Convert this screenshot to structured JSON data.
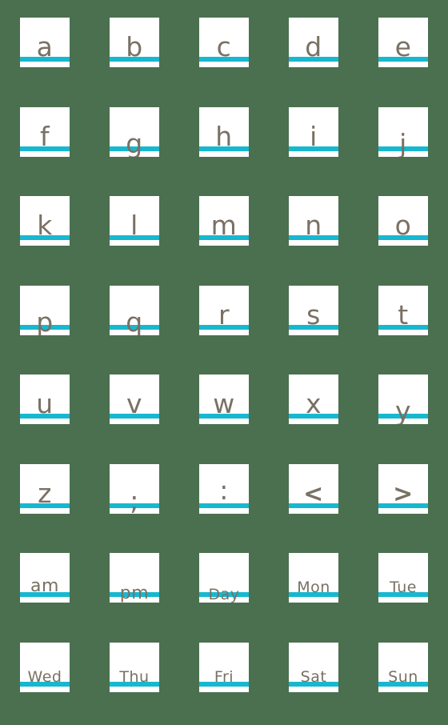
{
  "sheet": {
    "title": "Handwriting Letters and Days Emoji Sheet",
    "background_color": "#4a7050",
    "tile_color": "#ffffff",
    "rule_color": "#17b8cf",
    "glyph_color": "#7a7064",
    "columns": 5,
    "rows": 8
  },
  "tiles": [
    {
      "label": "a",
      "name": "tile-letter-a",
      "size": "s-single",
      "descender": "none"
    },
    {
      "label": "b",
      "name": "tile-letter-b",
      "size": "s-single",
      "descender": "none"
    },
    {
      "label": "c",
      "name": "tile-letter-c",
      "size": "s-single",
      "descender": "none"
    },
    {
      "label": "d",
      "name": "tile-letter-d",
      "size": "s-single",
      "descender": "none"
    },
    {
      "label": "e",
      "name": "tile-letter-e",
      "size": "s-single",
      "descender": "none"
    },
    {
      "label": "f",
      "name": "tile-letter-f",
      "size": "s-single",
      "descender": "none"
    },
    {
      "label": "g",
      "name": "tile-letter-g",
      "size": "s-single",
      "descender": "deep"
    },
    {
      "label": "h",
      "name": "tile-letter-h",
      "size": "s-single",
      "descender": "none"
    },
    {
      "label": "i",
      "name": "tile-letter-i",
      "size": "s-single",
      "descender": "none"
    },
    {
      "label": "j",
      "name": "tile-letter-j",
      "size": "s-single",
      "descender": "deep"
    },
    {
      "label": "k",
      "name": "tile-letter-k",
      "size": "s-single",
      "descender": "none"
    },
    {
      "label": "l",
      "name": "tile-letter-l",
      "size": "s-single",
      "descender": "none"
    },
    {
      "label": "m",
      "name": "tile-letter-m",
      "size": "s-single",
      "descender": "none"
    },
    {
      "label": "n",
      "name": "tile-letter-n",
      "size": "s-single",
      "descender": "none"
    },
    {
      "label": "o",
      "name": "tile-letter-o",
      "size": "s-single",
      "descender": "none"
    },
    {
      "label": "p",
      "name": "tile-letter-p",
      "size": "s-single",
      "descender": "deep"
    },
    {
      "label": "q",
      "name": "tile-letter-q",
      "size": "s-single",
      "descender": "deep"
    },
    {
      "label": "r",
      "name": "tile-letter-r",
      "size": "s-single",
      "descender": "none"
    },
    {
      "label": "s",
      "name": "tile-letter-s",
      "size": "s-single",
      "descender": "none"
    },
    {
      "label": "t",
      "name": "tile-letter-t",
      "size": "s-single",
      "descender": "none"
    },
    {
      "label": "u",
      "name": "tile-letter-u",
      "size": "s-single",
      "descender": "none"
    },
    {
      "label": "v",
      "name": "tile-letter-v",
      "size": "s-single",
      "descender": "none"
    },
    {
      "label": "w",
      "name": "tile-letter-w",
      "size": "s-single",
      "descender": "none"
    },
    {
      "label": "x",
      "name": "tile-letter-x",
      "size": "s-single",
      "descender": "none"
    },
    {
      "label": "y",
      "name": "tile-letter-y",
      "size": "s-single",
      "descender": "deep"
    },
    {
      "label": "z",
      "name": "tile-letter-z",
      "size": "s-single",
      "descender": "none"
    },
    {
      "label": ";",
      "name": "tile-semicolon",
      "size": "s-punct",
      "descender": "deep"
    },
    {
      "label": ":",
      "name": "tile-colon",
      "size": "s-punct",
      "descender": "raise"
    },
    {
      "label": "<",
      "name": "tile-less-than",
      "size": "s-angle",
      "descender": "none"
    },
    {
      "label": ">",
      "name": "tile-greater-than",
      "size": "s-angle",
      "descender": "none"
    },
    {
      "label": "am",
      "name": "tile-am",
      "size": "s-pair",
      "descender": "none"
    },
    {
      "label": "pm",
      "name": "tile-pm",
      "size": "s-pair",
      "descender": "deep"
    },
    {
      "label": "Day",
      "name": "tile-day",
      "size": "s-trio",
      "descender": "deep"
    },
    {
      "label": "Mon",
      "name": "tile-mon",
      "size": "s-trio",
      "descender": "none"
    },
    {
      "label": "Tue",
      "name": "tile-tue",
      "size": "s-trio",
      "descender": "none"
    },
    {
      "label": "Wed",
      "name": "tile-wed",
      "size": "s-trio",
      "descender": "none"
    },
    {
      "label": "Thu",
      "name": "tile-thu",
      "size": "s-trio",
      "descender": "none"
    },
    {
      "label": "Fri",
      "name": "tile-fri",
      "size": "s-trio",
      "descender": "none"
    },
    {
      "label": "Sat",
      "name": "tile-sat",
      "size": "s-trio",
      "descender": "none"
    },
    {
      "label": "Sun",
      "name": "tile-sun",
      "size": "s-trio",
      "descender": "none"
    }
  ]
}
